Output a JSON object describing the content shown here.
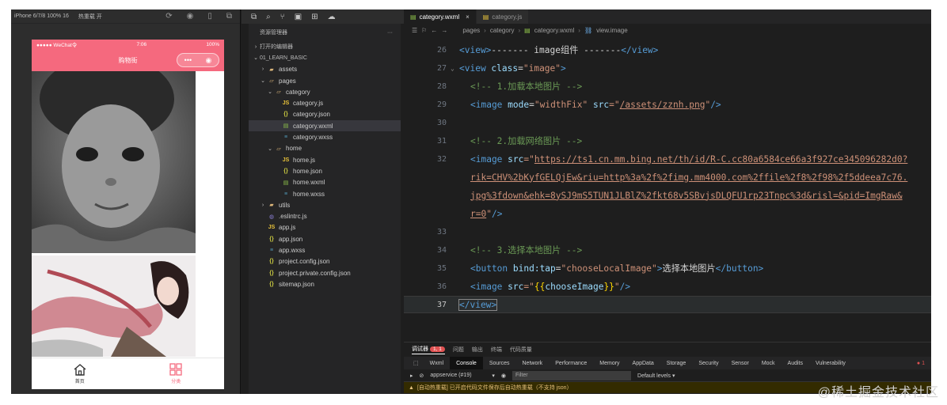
{
  "simulator": {
    "device": "iPhone 6/7/8 100% 16",
    "hot_reload": "热重载 开",
    "status_carrier": "●●●●● WeChat令",
    "status_time": "7:06",
    "status_battery": "100%",
    "nav_title": "购物街",
    "capsule_more": "•••",
    "capsule_close": "◉",
    "tabs": [
      {
        "label": "首页",
        "icon": "home-icon"
      },
      {
        "label": "分类",
        "icon": "category-icon"
      }
    ]
  },
  "explorer": {
    "title": "资源管理器",
    "more": "···",
    "sections": {
      "open_editors": "打开的编辑器",
      "project": "01_LEARN_BASIC"
    },
    "items": [
      {
        "label": "assets",
        "type": "folder",
        "depth": 1
      },
      {
        "label": "pages",
        "type": "folder-open",
        "depth": 1
      },
      {
        "label": "category",
        "type": "folder-open",
        "depth": 2
      },
      {
        "label": "category.js",
        "type": "js",
        "depth": 3
      },
      {
        "label": "category.json",
        "type": "json",
        "depth": 3
      },
      {
        "label": "category.wxml",
        "type": "wxml",
        "depth": 3,
        "selected": true
      },
      {
        "label": "category.wxss",
        "type": "wxss",
        "depth": 3
      },
      {
        "label": "home",
        "type": "folder-open",
        "depth": 2
      },
      {
        "label": "home.js",
        "type": "js",
        "depth": 3
      },
      {
        "label": "home.json",
        "type": "json",
        "depth": 3
      },
      {
        "label": "home.wxml",
        "type": "wxml",
        "depth": 3
      },
      {
        "label": "home.wxss",
        "type": "wxss",
        "depth": 3
      },
      {
        "label": "utils",
        "type": "folder",
        "depth": 1
      },
      {
        "label": ".eslintrc.js",
        "type": "eslint",
        "depth": 1
      },
      {
        "label": "app.js",
        "type": "js",
        "depth": 1
      },
      {
        "label": "app.json",
        "type": "json",
        "depth": 1
      },
      {
        "label": "app.wxss",
        "type": "wxss",
        "depth": 1
      },
      {
        "label": "project.config.json",
        "type": "json",
        "depth": 1
      },
      {
        "label": "project.private.config.json",
        "type": "json",
        "depth": 1
      },
      {
        "label": "sitemap.json",
        "type": "json",
        "depth": 1
      }
    ]
  },
  "editor": {
    "tabs": [
      {
        "label": "category.wxml",
        "active": true,
        "close": "×"
      },
      {
        "label": "category.js",
        "active": false
      }
    ],
    "breadcrumb": [
      "pages",
      "category",
      "category.wxml",
      "view.image"
    ],
    "lines": {
      "n26": "26",
      "n27": "27",
      "n28": "28",
      "n29": "29",
      "n30": "30",
      "n31": "31",
      "n32": "32",
      "n33": "33",
      "n34": "34",
      "n35": "35",
      "n36": "36",
      "n37": "37",
      "l26_a": "<view>",
      "l26_b": "------- image组件 -------",
      "l26_c": "</view>",
      "l27_a": "<view ",
      "l27_b": "class",
      "l27_c": "=",
      "l27_d": "\"image\"",
      "l27_e": ">",
      "l28": "<!-- 1.加载本地图片 -->",
      "l29_a": "<image ",
      "l29_b": "mode",
      "l29_c": "=",
      "l29_d": "\"widthFix\"",
      "l29_e": " src",
      "l29_f": "=\"",
      "l29_g": "/assets/zznh.png",
      "l29_h": "\"",
      "l29_i": "/>",
      "l31": "<!-- 2.加载网络图片 -->",
      "l32_a": "<image ",
      "l32_b": "src",
      "l32_c": "=\"",
      "l32_url1": "https://ts1.cn.mm.bing.net/th/id/R-C.cc80a6584ce66a3f927ce345096282d0?",
      "l32_url2": "rik=CHV%2bKyfGELQjEw&riu=http%3a%2f%2fimg.mm4000.com%2ffile%2f8%2f98%2f5ddeea7c76.",
      "l32_url3": "jpg%3fdown&ehk=8ySJ9mS5TUN1JLBlZ%2fkt68v5SBvjsDLQFU1rp23Tnpc%3d&risl=&pid=ImgRaw&",
      "l32_url4": "r=0",
      "l32_end_q": "\"",
      "l32_end_t": "/>",
      "l34": "<!-- 3.选择本地图片 -->",
      "l35_a": "<button ",
      "l35_b": "bind:tap",
      "l35_c": "=",
      "l35_d": "\"chooseLocalImage\"",
      "l35_e": ">",
      "l35_f": "选择本地图片",
      "l35_g": "</button>",
      "l36_a": "<image ",
      "l36_b": "src",
      "l36_c": "=\"",
      "l36_d": "{{",
      "l36_e": "chooseImage",
      "l36_f": "}}",
      "l36_g": "\"",
      "l36_h": "/>",
      "l37": "</view>"
    }
  },
  "debug": {
    "tabs": [
      "调试器",
      "问题",
      "输出",
      "终端",
      "代码质量"
    ],
    "badge": "1, 1",
    "devtools_tabs": [
      "Wxml",
      "Console",
      "Sources",
      "Network",
      "Performance",
      "Memory",
      "AppData",
      "Storage",
      "Security",
      "Sensor",
      "Mock",
      "Audits",
      "Vulnerability"
    ],
    "error_count": "● 1",
    "context": "appservice (#19)",
    "filter_placeholder": "Filter",
    "levels": "Default levels ▾",
    "warning": "[自动热重载] 已开启代码文件保存后自动热重载（不支持 json）"
  },
  "watermark": "@稀土掘金技术社区"
}
